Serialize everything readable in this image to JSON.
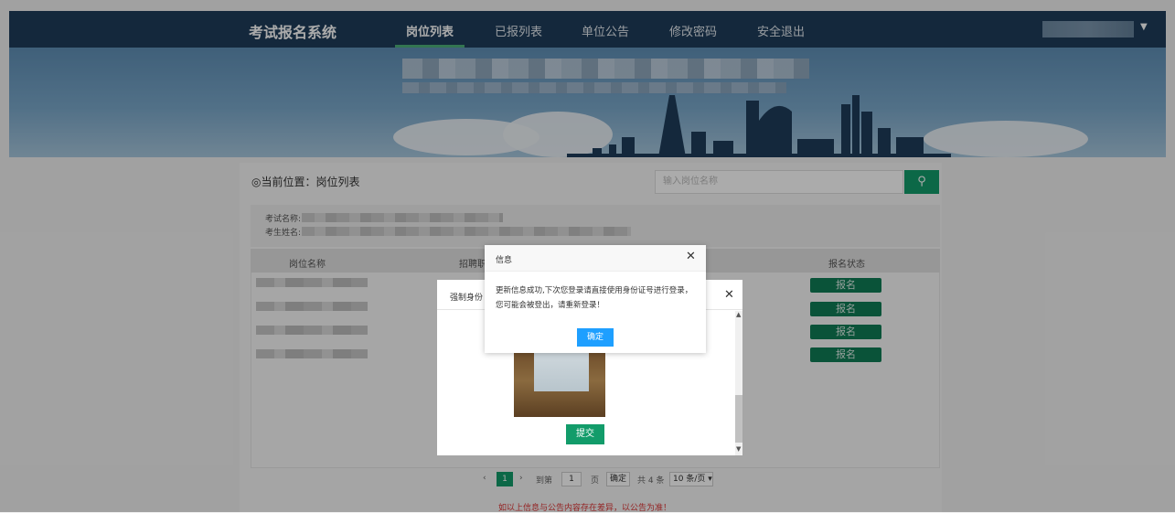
{
  "header": {
    "brand": "考试报名系统",
    "nav": [
      "岗位列表",
      "已报列表",
      "单位公告",
      "修改密码",
      "安全退出"
    ],
    "user_caret_icon": "caret-down-icon"
  },
  "location": {
    "label": "当前位置：岗位列表"
  },
  "search": {
    "placeholder": "输入岗位名称",
    "icon": "search-icon"
  },
  "info": {
    "exam_label": "考试名称:",
    "name_label": "考生姓名:"
  },
  "table": {
    "headers": [
      "岗位名称",
      "招聘职",
      "报名状态"
    ],
    "register_label": "报名"
  },
  "pager": {
    "current": "1",
    "goto": "到第",
    "page_value": "1",
    "page_unit": "页",
    "confirm": "确定",
    "total": "共 4 条",
    "per_page": "10 条/页"
  },
  "notice": "如以上信息与公告内容存在差异，以公告为准！",
  "dialog_identity": {
    "title": "强制身份",
    "submit": "提交"
  },
  "dialog_info": {
    "title": "信息",
    "message": "更新信息成功,下次您登录请直接使用身份证号进行登录，您可能会被登出，请重新登录！",
    "ok": "确定"
  },
  "colors": {
    "nav_bg": "#1f3d5a",
    "accent": "#129c6a",
    "register_btn": "#0f7d56",
    "ok_btn": "#1e9fff",
    "notice": "#dd3333"
  }
}
